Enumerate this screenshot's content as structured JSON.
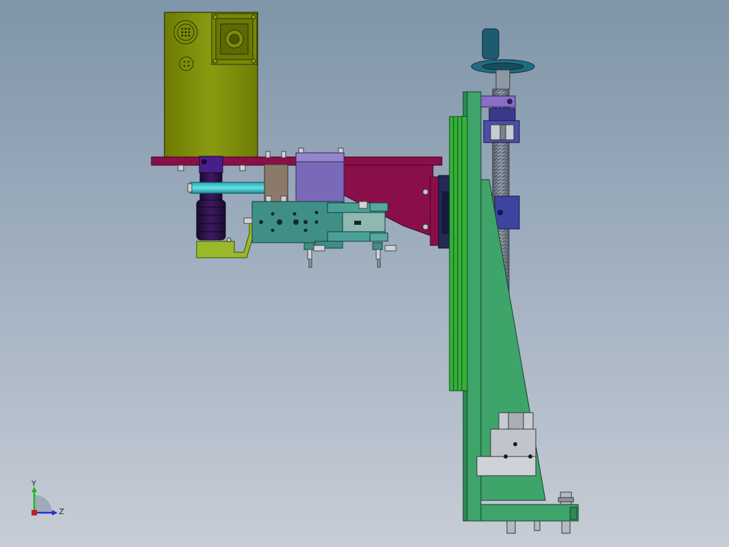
{
  "axes": {
    "y_label": "Y",
    "z_label": "Z"
  },
  "colors": {
    "background_top": "#7f95a8",
    "background_bottom": "#c7cdd6",
    "motor_yellow": "#7c8c08",
    "plate_magenta": "#8a0f49",
    "cylinder_purple": "#2c1048",
    "teal_block": "#3f8f86",
    "lavender_block": "#7a68b8",
    "frame_green": "#3fa46a",
    "slide_green": "#35b03a",
    "handwheel_teal": "#1c5c6e",
    "axis_y": "#18b818",
    "axis_z": "#1f2fd0"
  },
  "icons": {
    "triad": "coordinate-triad-icon",
    "handwheel": "handwheel-icon"
  }
}
